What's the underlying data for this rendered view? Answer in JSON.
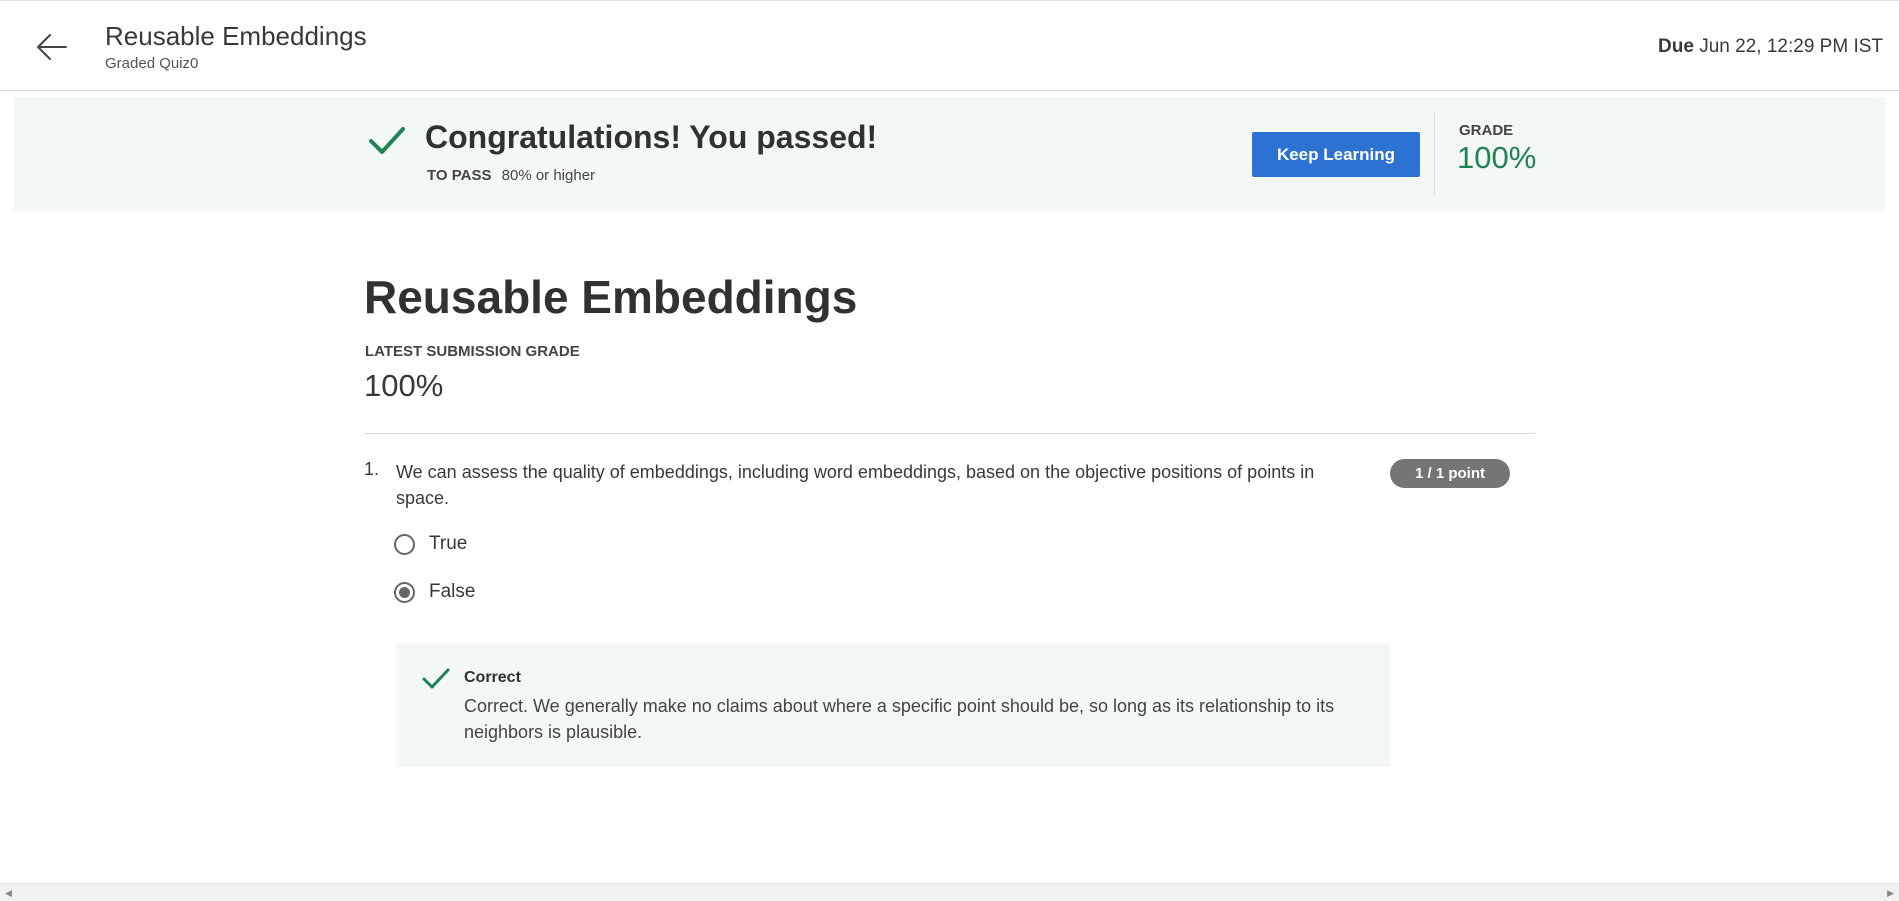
{
  "header": {
    "title": "Reusable Embeddings",
    "subtitle": "Graded Quiz0",
    "due_label": "Due",
    "due_value": "Jun 22, 12:29 PM IST",
    "back_icon": "arrow-left-icon"
  },
  "banner": {
    "title": "Congratulations! You passed!",
    "to_pass_label": "TO PASS",
    "to_pass_value": "80% or higher",
    "keep_learning_label": "Keep Learning",
    "grade_label": "GRADE",
    "grade_value": "100%",
    "check_icon": "checkmark-icon",
    "colors": {
      "background": "#f3f8f6",
      "accent_green": "#1f8354",
      "button_blue": "#2d72d2"
    }
  },
  "main": {
    "title": "Reusable Embeddings",
    "latest_label": "LATEST SUBMISSION GRADE",
    "latest_value": "100%"
  },
  "question": {
    "number": "1.",
    "text": "We can assess the quality of embeddings, including word embeddings, based on the objective positions of points in space.",
    "points": "1 / 1 point",
    "options": [
      {
        "label": "True",
        "selected": false
      },
      {
        "label": "False",
        "selected": true
      }
    ],
    "feedback": {
      "title": "Correct",
      "text": "Correct. We generally make no claims about where a specific point should be, so long as its relationship to its neighbors is plausible.",
      "icon": "checkmark-icon"
    }
  },
  "scrollbar": {
    "left_icon": "scroll-left-arrow-icon",
    "right_icon": "scroll-right-arrow-icon"
  }
}
